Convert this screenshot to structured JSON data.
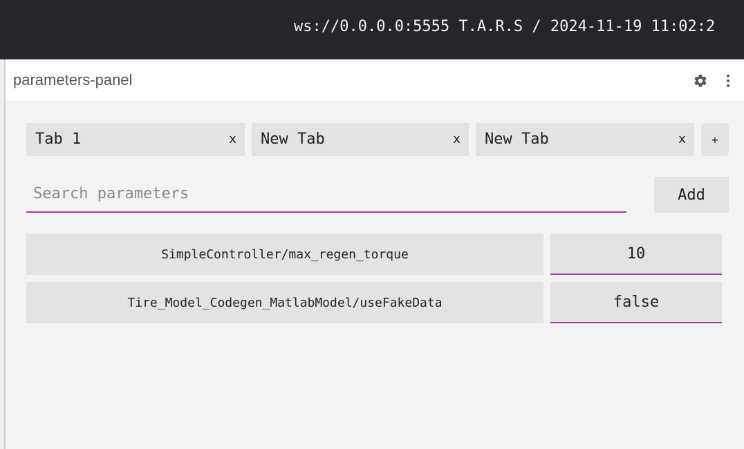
{
  "topbar": {
    "connection_text": "ws://0.0.0.0:5555 T.A.R.S / 2024-11-19 11:02:2"
  },
  "panel": {
    "title": "parameters-panel",
    "icons": [
      "gear-icon",
      "more-vertical-icon"
    ]
  },
  "tabs": [
    {
      "label": "Tab 1",
      "close": "x"
    },
    {
      "label": "New Tab",
      "close": "x"
    },
    {
      "label": "New Tab",
      "close": "x"
    }
  ],
  "add_tab_label": "+",
  "search": {
    "placeholder": "Search parameters",
    "value": ""
  },
  "add_button_label": "Add",
  "parameters": [
    {
      "name": "SimpleController/max_regen_torque",
      "value": "10"
    },
    {
      "name": "Tire_Model_Codegen_MatlabModel/useFakeData",
      "value": "false"
    }
  ],
  "colors": {
    "topbar_bg": "#25262a",
    "accent": "#9c3aa3",
    "panel_bg": "#f3f3f3",
    "chip_bg": "#e3e3e3"
  }
}
